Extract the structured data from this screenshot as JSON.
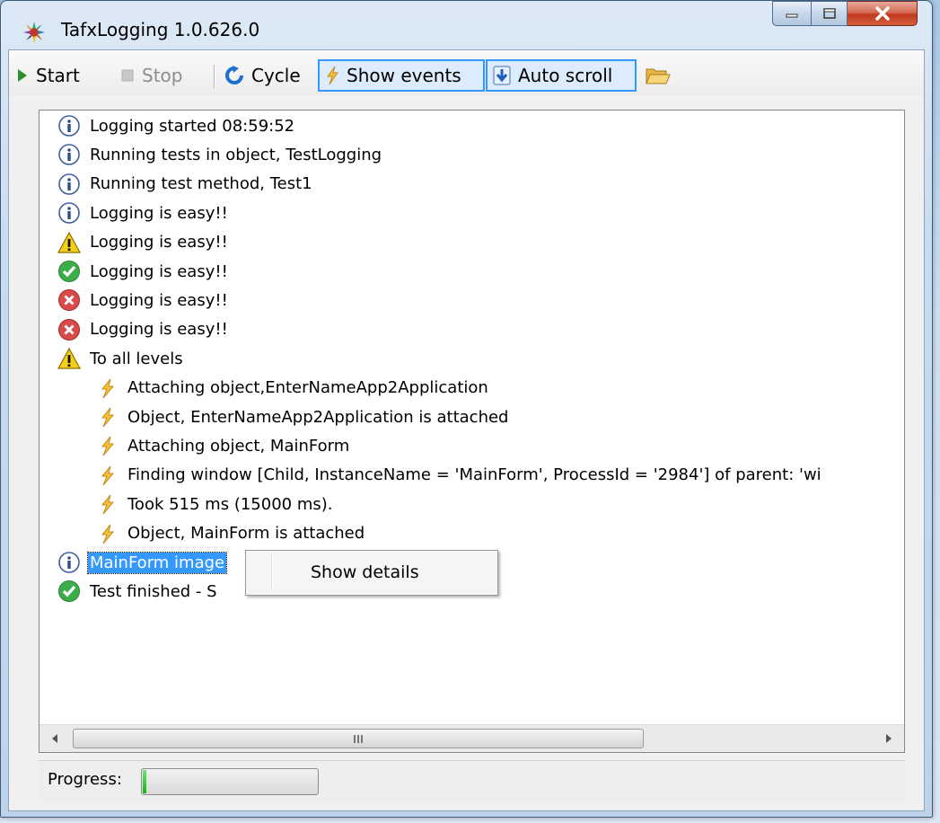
{
  "window": {
    "title": "TafxLogging 1.0.626.0"
  },
  "toolbar": {
    "start_label": "Start",
    "stop_label": "Stop",
    "cycle_label": "Cycle",
    "show_events_label": "Show events",
    "auto_scroll_label": "Auto scroll",
    "stop_enabled": false,
    "show_events_checked": true,
    "auto_scroll_checked": true
  },
  "log": {
    "items": [
      {
        "level": "info",
        "text": "Logging started 08:59:52"
      },
      {
        "level": "info",
        "text": "Running tests in object, TestLogging"
      },
      {
        "level": "info",
        "text": "Running test method, Test1"
      },
      {
        "level": "info",
        "text": "Logging is easy!!"
      },
      {
        "level": "warning",
        "text": "Logging is easy!!"
      },
      {
        "level": "success",
        "text": "Logging is easy!!"
      },
      {
        "level": "error",
        "text": "Logging is easy!!"
      },
      {
        "level": "error",
        "text": "Logging is easy!!"
      },
      {
        "level": "warning",
        "text": "To all levels"
      },
      {
        "level": "event",
        "text": "Attaching object,EnterNameApp2Application"
      },
      {
        "level": "event",
        "text": "Object, EnterNameApp2Application is attached"
      },
      {
        "level": "event",
        "text": "Attaching object, MainForm"
      },
      {
        "level": "event",
        "text": "Finding window [Child, InstanceName = 'MainForm', ProcessId = '2984'] of parent: 'wi"
      },
      {
        "level": "event",
        "text": "Took 515 ms (15000 ms)."
      },
      {
        "level": "event",
        "text": "Object, MainForm is attached"
      },
      {
        "level": "info",
        "text": "MainForm image",
        "selected": true
      },
      {
        "level": "success",
        "text": "Test finished - S"
      }
    ]
  },
  "context_menu": {
    "items": [
      "Show details"
    ]
  },
  "status": {
    "progress_label": "Progress:",
    "progress_fraction": 0.02
  },
  "colors": {
    "selection": "#3399ff",
    "checked_border": "#3399ff",
    "progress_fill": "#14b814"
  }
}
